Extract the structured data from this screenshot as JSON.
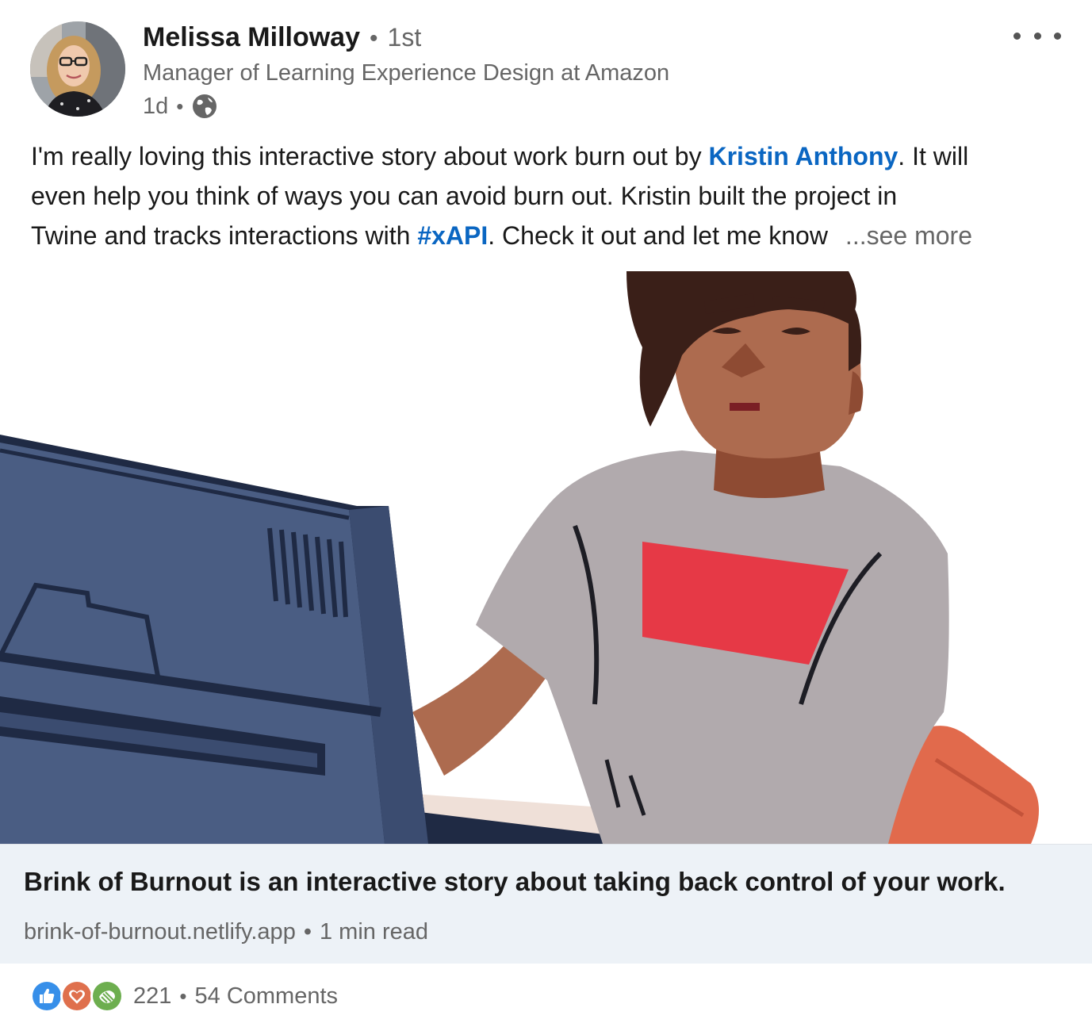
{
  "post": {
    "author": {
      "name": "Melissa Milloway",
      "separator": "•",
      "degree": "1st",
      "headline": "Manager of Learning Experience Design at Amazon",
      "time": "1d",
      "visibility_icon": "globe-icon"
    },
    "menu_icon": "more-options-icon",
    "text": {
      "line1_a": "I'm really loving this interactive story about work burn out by ",
      "mention": "Kristin Anthony",
      "line1_b": ". It will",
      "line2": "even help you think of ways you can avoid burn out. Kristin built the project in",
      "line3_a": "Twine and tracks interactions with ",
      "hashtag": "#xAPI",
      "line3_b": ". Check it out and let me know",
      "see_more": "...see more"
    },
    "link_preview": {
      "title": "Brink of Burnout is an interactive story about taking back control of your work.",
      "domain": "brink-of-burnout.netlify.app",
      "separator": "•",
      "read_time": "1 min read"
    },
    "social": {
      "reactions": [
        "like-icon",
        "love-icon",
        "support-icon"
      ],
      "reaction_count": "221",
      "separator": "•",
      "comments": "54 Comments"
    }
  },
  "colors": {
    "link_blue": "#0a66c2",
    "link_bar_bg": "#edf2f7",
    "secondary_text": "#666666"
  }
}
